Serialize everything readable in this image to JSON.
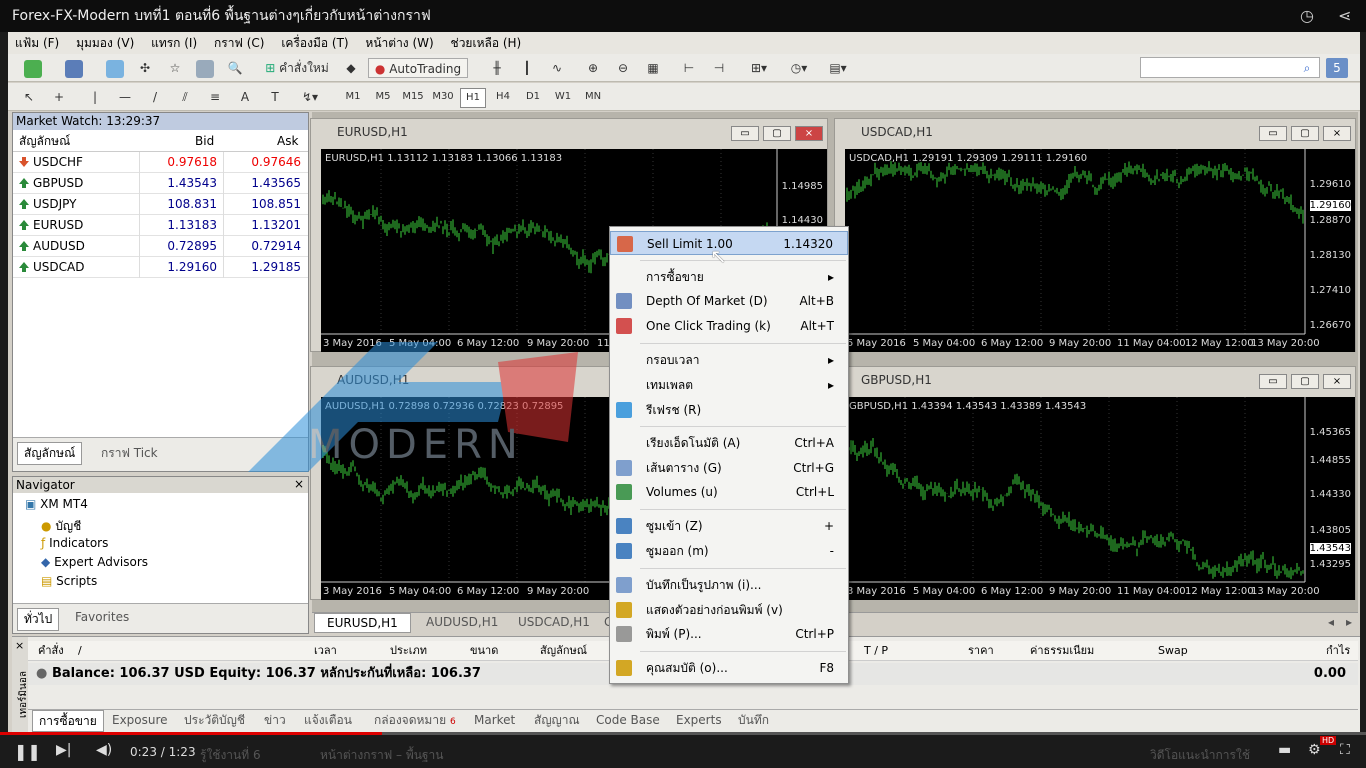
{
  "video": {
    "title": "Forex-FX-Modern บทที่1  ตอนที่6  พื้นฐานต่างๆเกี่ยวกับหน้าต่างกราฟ",
    "time_current": "0:23",
    "time_total": "1:23",
    "progress": 0.28,
    "subtitle_text": "หน้าต่างกราฟ – พื้นฐาน",
    "subtitle_left": "รู้ใช้งานที่ 6",
    "subtitle_right": "วิดีโอแนะนำการใช้",
    "hd_badge": "HD"
  },
  "menu": [
    "แฟ้ม (F)",
    "มุมมอง (V)",
    "แทรก (I)",
    "กราฟ (C)",
    "เครื่องมือ (T)",
    "หน้าต่าง (W)",
    "ช่วยเหลือ (H)"
  ],
  "toolbar": {
    "new_order": "คำสั่งใหม่",
    "autotrading": "AutoTrading",
    "timeframes": [
      "M1",
      "M5",
      "M15",
      "M30",
      "H1",
      "H4",
      "D1",
      "W1",
      "MN"
    ],
    "selected_timeframe": "H1",
    "search_placeholder": ""
  },
  "market_watch": {
    "title": "Market Watch: 13:29:37",
    "col_symbol": "สัญลักษณ์",
    "col_bid": "Bid",
    "col_ask": "Ask",
    "rows": [
      {
        "symbol": "USDCHF",
        "bid": "0.97618",
        "ask": "0.97646",
        "dir": "down"
      },
      {
        "symbol": "GBPUSD",
        "bid": "1.43543",
        "ask": "1.43565",
        "dir": "up"
      },
      {
        "symbol": "USDJPY",
        "bid": "108.831",
        "ask": "108.851",
        "dir": "up"
      },
      {
        "symbol": "EURUSD",
        "bid": "1.13183",
        "ask": "1.13201",
        "dir": "up"
      },
      {
        "symbol": "AUDUSD",
        "bid": "0.72895",
        "ask": "0.72914",
        "dir": "up"
      },
      {
        "symbol": "USDCAD",
        "bid": "1.29160",
        "ask": "1.29185",
        "dir": "up"
      }
    ],
    "tabs": [
      "สัญลักษณ์",
      "กราฟ Tick"
    ]
  },
  "navigator": {
    "title": "Navigator",
    "root": "XM MT4",
    "items": [
      "บัญชี",
      "Indicators",
      "Expert Advisors",
      "Scripts"
    ],
    "tabs": [
      "ทั่วไป",
      "Favorites"
    ]
  },
  "charts": [
    {
      "title": "EURUSD,H1",
      "info": "EURUSD,H1  1.13112 1.13183 1.13066 1.13183",
      "prices": [
        "1.14985",
        "1.14430"
      ],
      "dates": [
        "3 May 2016",
        "5 May 04:00",
        "6 May 12:00",
        "9 May 20:00",
        "11"
      ]
    },
    {
      "title": "USDCAD,H1",
      "info": "USDCAD,H1  1.29191 1.29309 1.29111 1.29160",
      "prices": [
        "1.29610",
        "1.29160",
        "1.28870",
        "1.28130",
        "1.27410",
        "1.26670"
      ],
      "dates": [
        "5 May 2016",
        "5 May 04:00",
        "6 May 12:00",
        "9 May 20:00",
        "11 May 04:00",
        "12 May 12:00",
        "13 May 20:00"
      ]
    },
    {
      "title": "AUDUSD,H1",
      "info": "AUDUSD,H1  0.72898 0.72936 0.72823 0.72895",
      "prices": [],
      "dates": [
        "3 May 2016",
        "5 May 04:00",
        "6 May 12:00",
        "9 May 20:00"
      ]
    },
    {
      "title": "GBPUSD,H1",
      "info": "GBPUSD,H1  1.43394 1.43543 1.43389 1.43543",
      "prices": [
        "1.45365",
        "1.44855",
        "1.44330",
        "1.43805",
        "1.43543",
        "1.43295"
      ],
      "dates": [
        "3 May 2016",
        "5 May 04:00",
        "6 May 12:00",
        "9 May 20:00",
        "11 May 04:00",
        "12 May 12:00",
        "13 May 20:00"
      ]
    }
  ],
  "chart_tabs": [
    "EURUSD,H1",
    "AUDUSD,H1",
    "USDCAD,H1",
    "G"
  ],
  "context_menu": {
    "items": [
      {
        "label": "Sell Limit 1.00",
        "shortcut": "1.14320",
        "icon": "sell-limit-icon"
      },
      {
        "label": "การซื้อขาย",
        "shortcut": "▸",
        "icon": ""
      },
      {
        "label": "Depth Of Market (D)",
        "shortcut": "Alt+B",
        "icon": "depth-of-market-icon"
      },
      {
        "label": "One Click Trading (k)",
        "shortcut": "Alt+T",
        "icon": "one-click-icon"
      },
      {
        "label": "กรอบเวลา",
        "shortcut": "▸",
        "icon": ""
      },
      {
        "label": "เทมเพลต",
        "shortcut": "▸",
        "icon": ""
      },
      {
        "label": "รีเฟรช (R)",
        "shortcut": "",
        "icon": "refresh-icon"
      },
      {
        "label": "เรียงเอ็ดโนมัติ (A)",
        "shortcut": "Ctrl+A",
        "icon": ""
      },
      {
        "label": "เส้นตาราง (G)",
        "shortcut": "Ctrl+G",
        "icon": "grid-icon"
      },
      {
        "label": "Volumes (u)",
        "shortcut": "Ctrl+L",
        "icon": "volumes-icon"
      },
      {
        "label": "ซูมเข้า (Z)",
        "shortcut": "+",
        "icon": "zoom-in-icon"
      },
      {
        "label": "ซูมออก (m)",
        "shortcut": "-",
        "icon": "zoom-out-icon"
      },
      {
        "label": "บันทึกเป็นรูปภาพ (i)...",
        "shortcut": "",
        "icon": "save-image-icon"
      },
      {
        "label": "แสดงตัวอย่างก่อนพิมพ์ (v)",
        "shortcut": "",
        "icon": "print-preview-icon"
      },
      {
        "label": "พิมพ์ (P)...",
        "shortcut": "Ctrl+P",
        "icon": "print-icon"
      },
      {
        "label": "คุณสมบัติ (o)...",
        "shortcut": "F8",
        "icon": "properties-icon"
      }
    ]
  },
  "terminal": {
    "columns": [
      "คำสั่ง",
      "/",
      "เวลา",
      "ประเภท",
      "ขนาด",
      "สัญลักษณ์",
      "T / P",
      "ราคา",
      "ค่าธรรมเนียม",
      "Swap",
      "กำไร"
    ],
    "balance_line": "Balance: 106.37 USD  Equity: 106.37  หลักประกันที่เหลือ:  106.37",
    "profit": "0.00",
    "side_label": "เทอร์มินอล",
    "tabs": [
      "การซื้อขาย",
      "Exposure",
      "ประวัติบัญชี",
      "ข่าว",
      "แจ้งเตือน",
      "กล่องจดหมาย",
      "Market",
      "สัญญาณ",
      "Code Base",
      "Experts",
      "บันทึก"
    ],
    "mailbox_count": "6"
  },
  "watermark": {
    "text": "MODERN"
  }
}
